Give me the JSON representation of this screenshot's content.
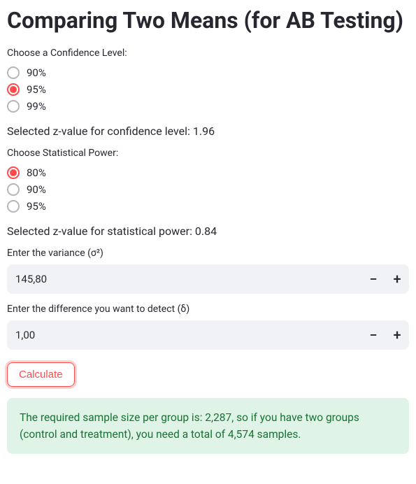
{
  "title": "Comparing Two Means (for AB Testing)",
  "confidence": {
    "label": "Choose a Confidence Level:",
    "options": [
      {
        "label": "90%",
        "checked": false
      },
      {
        "label": "95%",
        "checked": true
      },
      {
        "label": "99%",
        "checked": false
      }
    ],
    "selected_text_prefix": "Selected z-value for confidence level: ",
    "selected_z": "1.96"
  },
  "power": {
    "label": "Choose Statistical Power:",
    "options": [
      {
        "label": "80%",
        "checked": true
      },
      {
        "label": "90%",
        "checked": false
      },
      {
        "label": "95%",
        "checked": false
      }
    ],
    "selected_text_prefix": "Selected z-value for statistical power: ",
    "selected_z": "0.84"
  },
  "variance": {
    "label": "Enter the variance (σ²)",
    "value": "145,80"
  },
  "difference": {
    "label": "Enter the difference you want to detect (δ)",
    "value": "1,00"
  },
  "buttons": {
    "calculate": "Calculate",
    "minus": "−",
    "plus": "+"
  },
  "result": {
    "text": "The required sample size per group is: 2,287, so if you have two groups (control and treatment), you need a total of 4,574 samples."
  }
}
